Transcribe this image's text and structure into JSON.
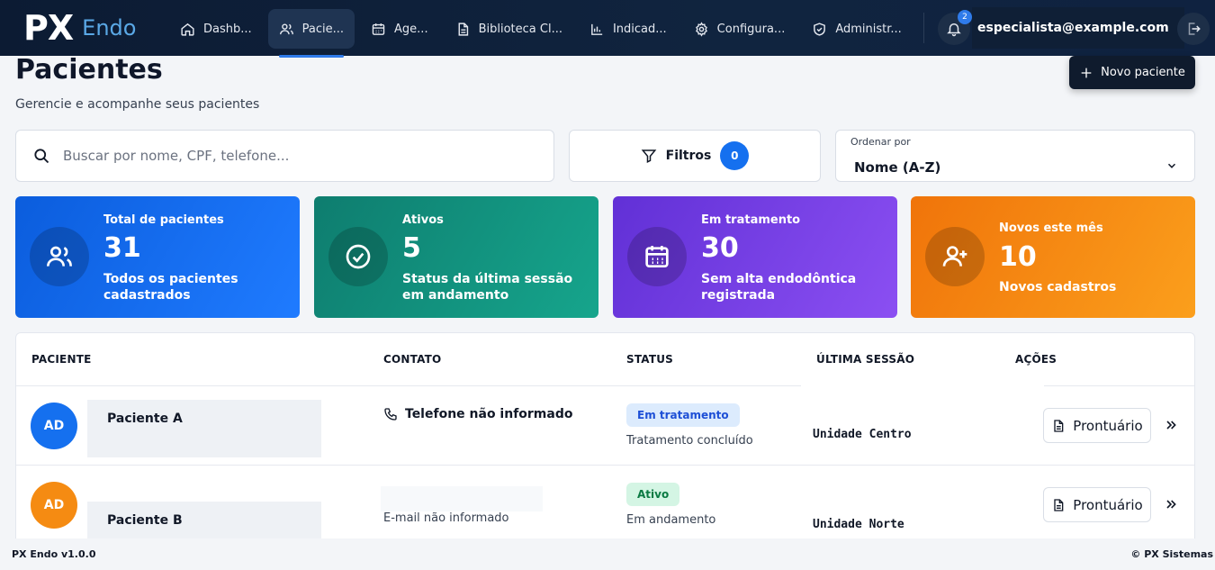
{
  "app": {
    "logo_main": "PX",
    "logo_sub": "Endo"
  },
  "nav": {
    "items": [
      {
        "label": "Dashb...",
        "icon": "home-icon"
      },
      {
        "label": "Pacie...",
        "icon": "users-icon",
        "active": true
      },
      {
        "label": "Age...",
        "icon": "calendar-icon"
      },
      {
        "label": "Biblioteca Cl...",
        "icon": "document-icon"
      },
      {
        "label": "Indicad...",
        "icon": "chart-icon"
      },
      {
        "label": "Configura...",
        "icon": "gear-icon"
      },
      {
        "label": "Administr...",
        "icon": "shield-icon"
      }
    ],
    "notification_count": "2",
    "user_email": "especialista@example.com"
  },
  "header": {
    "title": "Pacientes",
    "subtitle": "Gerencie e acompanhe seus pacientes",
    "new_button": "Novo paciente"
  },
  "filters": {
    "search_placeholder": "Buscar por nome, CPF, telefone...",
    "filters_label": "Filtros",
    "filters_count": "0",
    "sort_label": "Ordenar por",
    "sort_value": "Nome (A-Z)"
  },
  "stats": [
    {
      "title": "Total de pacientes",
      "value": "31",
      "desc": "Todos os pacientes cadastrados",
      "icon": "users-icon",
      "color": "#1570ef"
    },
    {
      "title": "Ativos",
      "value": "5",
      "desc": "Status da última sessão em andamento",
      "icon": "check-circle-icon",
      "color": "#0f9580"
    },
    {
      "title": "Em tratamento",
      "value": "30",
      "desc": "Sem alta endodôntica registrada",
      "icon": "calendar-icon",
      "color": "#7a40ea"
    },
    {
      "title": "Novos este mês",
      "value": "10",
      "desc": "Novos cadastros",
      "icon": "user-plus-icon",
      "color": "#f58b12"
    }
  ],
  "table": {
    "headers": [
      "PACIENTE",
      "CONTATO",
      "STATUS",
      "ÚLTIMA SESSÃO",
      "AÇÕES"
    ],
    "rows": [
      {
        "initials": "AD",
        "avatar_color": "#1570ef",
        "name": "Paciente A",
        "contact": "Telefone não informado",
        "status": "Em tratamento",
        "status_detail": "Tratamento concluído",
        "last_session": "Unidade Centro",
        "action": "Prontuário"
      },
      {
        "initials": "AD",
        "avatar_color": "#f58b12",
        "name": "Paciente B",
        "contact": "E-mail não informado",
        "status": "Ativo",
        "status_detail": "Em andamento",
        "last_session": "Unidade Norte",
        "action": "Prontuário"
      }
    ]
  },
  "footer": {
    "version": "PX Endo v1.0.0",
    "copyright": "© PX Sistemas"
  }
}
